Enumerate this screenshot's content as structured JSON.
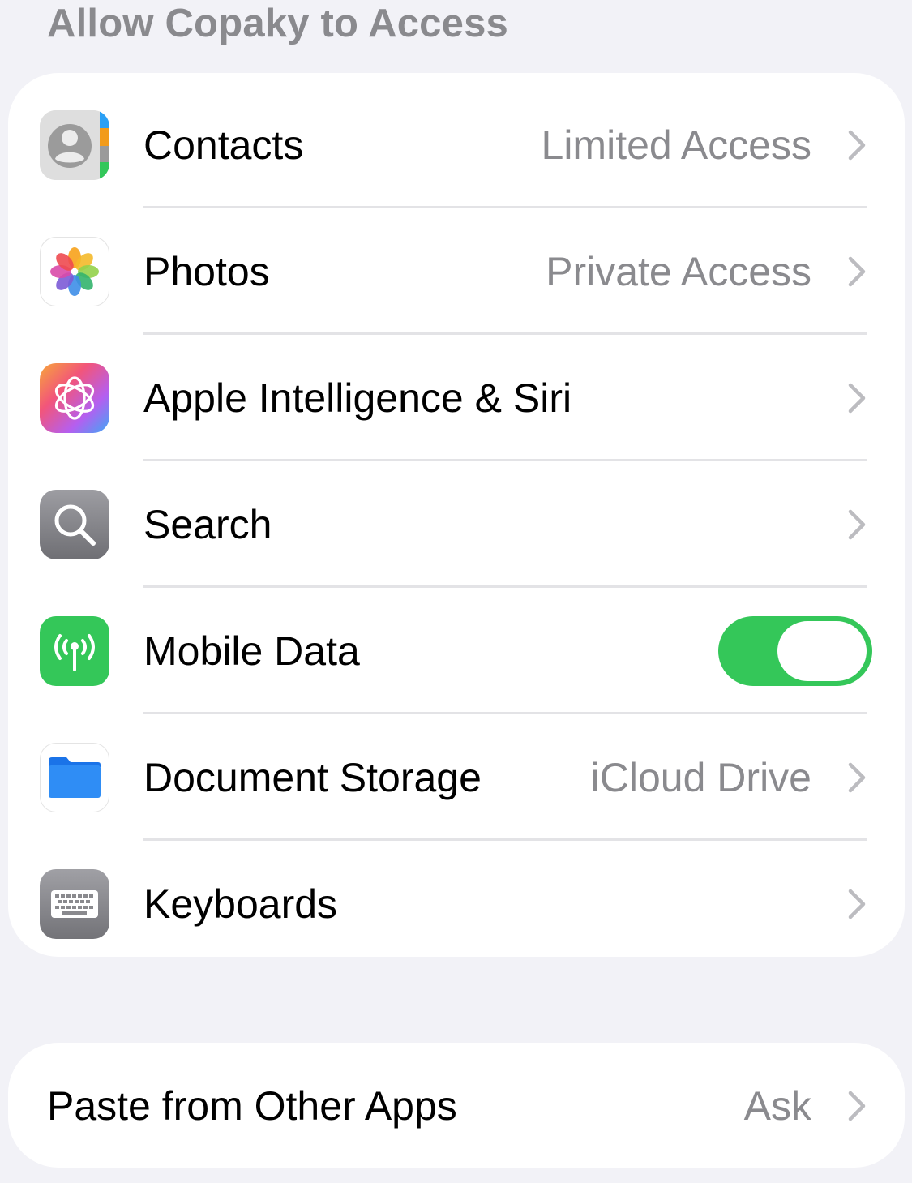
{
  "section_header": "Allow Copaky to Access",
  "permissions": [
    {
      "label": "Contacts",
      "value": "Limited Access",
      "icon": "contacts-icon"
    },
    {
      "label": "Photos",
      "value": "Private Access",
      "icon": "photos-icon"
    },
    {
      "label": "Apple Intelligence & Siri",
      "value": "",
      "icon": "apple-intelligence-icon"
    },
    {
      "label": "Search",
      "value": "",
      "icon": "search-icon"
    },
    {
      "label": "Mobile Data",
      "toggle_on": true,
      "icon": "antenna-icon"
    },
    {
      "label": "Document Storage",
      "value": "iCloud Drive",
      "icon": "folder-icon"
    },
    {
      "label": "Keyboards",
      "value": "",
      "icon": "keyboard-icon"
    }
  ],
  "paste": {
    "label": "Paste from Other Apps",
    "value": "Ask"
  },
  "colors": {
    "background": "#f2f2f7",
    "group": "#ffffff",
    "secondary_text": "#8a8a8e",
    "toggle_on": "#34c759",
    "chevron": "#bcbcc0"
  }
}
